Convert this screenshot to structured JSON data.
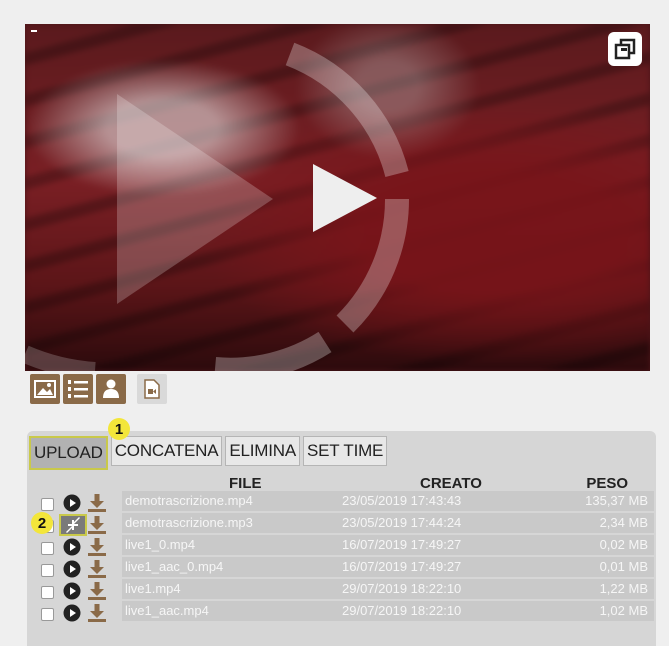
{
  "toolbar": {
    "tabs": [
      "UPLOAD",
      "CONCATENA",
      "ELIMINA",
      "SET TIME"
    ]
  },
  "badges": {
    "one": "1",
    "two": "2"
  },
  "table": {
    "headers": {
      "file": "FILE",
      "created": "CREATO",
      "size": "PESO"
    },
    "rows": [
      {
        "file": "demotrascrizione.mp4",
        "created": "23/05/2019 17:43:43",
        "size": "135,37 MB"
      },
      {
        "file": "demotrascrizione.mp3",
        "created": "23/05/2019 17:44:24",
        "size": "2,34 MB"
      },
      {
        "file": "live1_0.mp4",
        "created": "16/07/2019 17:49:27",
        "size": "0,02 MB"
      },
      {
        "file": "live1_aac_0.mp4",
        "created": "16/07/2019 17:49:27",
        "size": "0,01 MB"
      },
      {
        "file": "live1.mp4",
        "created": "29/07/2019 18:22:10",
        "size": "1,22 MB"
      },
      {
        "file": "live1_aac.mp4",
        "created": "29/07/2019 18:22:10",
        "size": "1,02 MB"
      }
    ]
  },
  "icons": {
    "player": [
      "pip-icon",
      "play-icon"
    ],
    "iconbar": [
      "image-icon",
      "numbered-list-icon",
      "user-icon",
      "video-file-icon"
    ],
    "row": [
      "checkbox",
      "play-circle-icon",
      "download-icon",
      "compress-icon"
    ]
  },
  "colors": {
    "accent_brown": "#8a6a48",
    "highlight_yellow": "#f3e63a",
    "row_bg": "#c9c9c9"
  }
}
